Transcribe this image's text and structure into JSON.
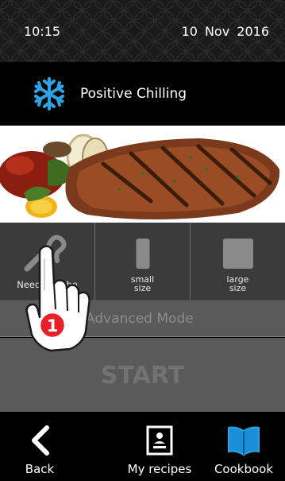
{
  "status": {
    "time": "10:15",
    "date": "10 Nov 2016"
  },
  "mode": {
    "label": "Positive Chilling",
    "icon": "snowflake-icon",
    "icon_color": "#2aa4e6"
  },
  "options": [
    {
      "label": "Needle Probe",
      "icon": "needle-probe-icon"
    },
    {
      "label": "small size",
      "icon": "small-size-icon"
    },
    {
      "label": "large size",
      "icon": "large-size-icon"
    }
  ],
  "advanced": {
    "label": "Advanced Mode"
  },
  "start": {
    "label": "START"
  },
  "nav": {
    "back": "Back",
    "recipes": "My recipes",
    "cookbook": "Cookbook"
  },
  "annotation": {
    "step": "1",
    "color": "#e8202a"
  },
  "colors": {
    "accent_blue": "#2aa4e6",
    "panel_gray": "#5a5a5a"
  }
}
